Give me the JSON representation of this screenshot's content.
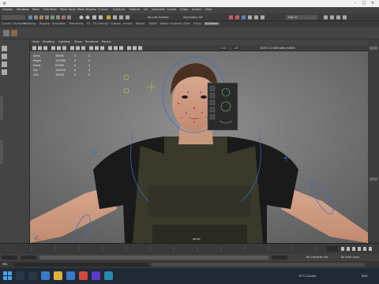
{
  "menubar": {
    "items": [
      "Display",
      "Windows",
      "Mesh",
      "Edit Mesh",
      "Mesh Tools",
      "Mesh Display",
      "Curves",
      "Surfaces",
      "Deform",
      "UV",
      "Generate",
      "Cache",
      "V-Ray",
      "Arnold",
      "Help"
    ]
  },
  "statusline": {
    "no_live_surface": "No Live Surface",
    "symmetry": "Symmetry: Off",
    "sign_in": "Sign In"
  },
  "shelf_tabs": [
    "Curves / Surfaces",
    "Modeling",
    "Rigging",
    "Animation",
    "Rendering",
    "FX",
    "FX Caching",
    "Custom",
    "Arnold",
    "Bifrost",
    "MASH",
    "Motion Graphics",
    "XGen",
    "V-Ray",
    "BaTeMate"
  ],
  "shelf_active_tab": "BaTeMate",
  "panel_menu": [
    "View",
    "Shading",
    "Lighting",
    "Show",
    "Renderer",
    "Panels"
  ],
  "panel_bar": {
    "near": "0.00",
    "far": "1.00",
    "colorspace": "ACES 1.0 SDR-video (sRGB)"
  },
  "hud": {
    "rows": [
      {
        "label": "Verts",
        "v1": "39095",
        "v2": "0",
        "v3": "0"
      },
      {
        "label": "Edges",
        "v1": "147360",
        "v2": "0",
        "v3": "0"
      },
      {
        "label": "Faces",
        "v1": "81580",
        "v2": "0",
        "v3": "0"
      },
      {
        "label": "Tris",
        "v1": "104430",
        "v2": "0",
        "v3": "0"
      },
      {
        "label": "UVs",
        "v1": "78678",
        "v2": "0",
        "v3": "0"
      }
    ]
  },
  "viewport_label": "persp",
  "rangeslider": {
    "no_character_set": "No Character Set",
    "no_anim_layer": "No Anim Layer"
  },
  "cmdline": {
    "lang": "MEL"
  },
  "taskbar": {
    "weather": "15°C  Cloudy",
    "lang": "ENG"
  },
  "colors": {
    "accent": "#00a0e0",
    "viewport_bg": "#8a8a8a"
  }
}
